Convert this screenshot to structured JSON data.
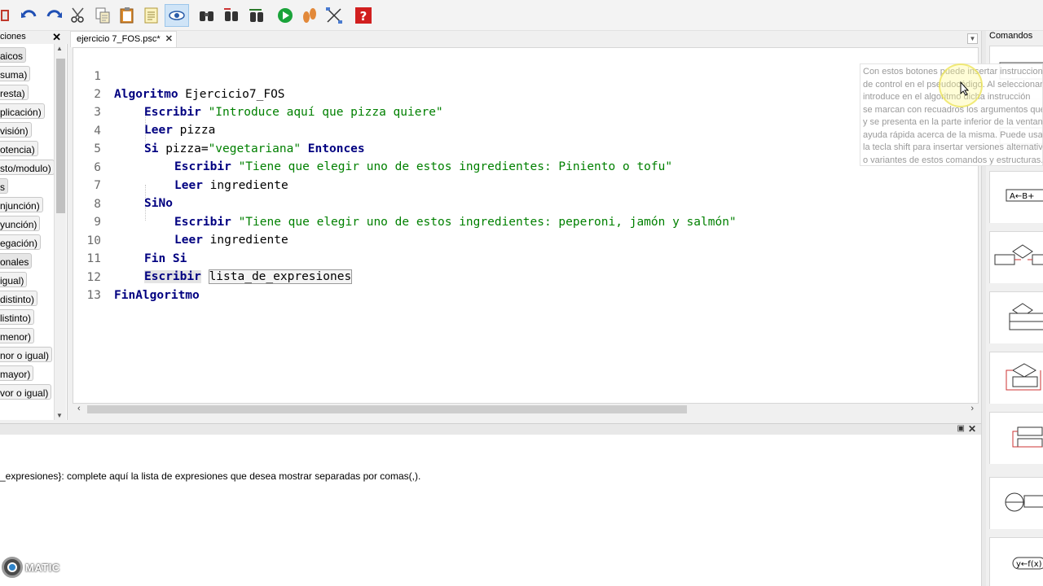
{
  "toolbar": {
    "buttons": [
      "open-icon",
      "undo-icon",
      "redo-icon",
      "cut-icon",
      "copy-icon",
      "paste-icon",
      "notes-icon",
      "find-preview-icon",
      "find-icon",
      "replace-icon",
      "indent-icon",
      "run-icon",
      "step-icon",
      "flow-icon",
      "help-icon"
    ]
  },
  "left_panel": {
    "title": "ciones",
    "items": [
      "aicos",
      "suma)",
      "resta)",
      "plicación)",
      "visión)",
      "otencia)",
      "sto/modulo)",
      "s",
      "njunción)",
      "yunción)",
      "egación)",
      "onales",
      "igual)",
      "distinto)",
      "listinto)",
      "menor)",
      "nor o igual)",
      "mayor)",
      "vor o igual)"
    ]
  },
  "tab": {
    "label": "ejercicio 7_FOS.psc*"
  },
  "code": {
    "lines": [
      {
        "n": "1"
      },
      {
        "n": "2"
      },
      {
        "n": "3"
      },
      {
        "n": "4"
      },
      {
        "n": "5"
      },
      {
        "n": "6"
      },
      {
        "n": "7"
      },
      {
        "n": "8"
      },
      {
        "n": "9"
      },
      {
        "n": "10"
      },
      {
        "n": "11"
      },
      {
        "n": "12"
      },
      {
        "n": "13"
      }
    ],
    "l1_kw": "Algoritmo",
    "l1_id": " Ejercicio7_FOS",
    "l2_kw": "Escribir",
    "l2_str": " \"Introduce aquí que pizza quiere\"",
    "l3_kw": "Leer",
    "l3_id": " pizza",
    "l4_kw": "Si",
    "l4_id": " pizza=",
    "l4_str": "\"vegetariana\"",
    "l4_kw2": " Entonces",
    "l5_kw": "Escribir",
    "l5_str": " \"Tiene que elegir uno de estos ingredientes: Piniento o tofu\"",
    "l6_kw": "Leer",
    "l6_id": " ingrediente",
    "l7_kw": "SiNo",
    "l8_kw": "Escribir",
    "l8_str": " \"Tiene que elegir uno de estos ingredientes: peperoni, jamón y salmón\"",
    "l9_kw": "Leer",
    "l9_id": " ingrediente",
    "l10_kw": "Fin Si",
    "l11_kw": "Escribir",
    "l11_arg": "lista_de_expresiones",
    "l12_kw": "FinAlgoritmo"
  },
  "help": {
    "text": "_expresiones}: complete aquí la lista de expresiones que desea mostrar separadas por comas(,)."
  },
  "logo": {
    "text": "MATIC"
  },
  "right_panel": {
    "title": "Comandos",
    "items": [
      "escribir-command-icon",
      "leer-command-icon",
      "asignar-command-icon",
      "si-entonces-command-icon",
      "segun-command-icon",
      "mientras-command-icon",
      "repetir-command-icon",
      "para-command-icon",
      "funcion-command-icon"
    ]
  },
  "tooltip": {
    "lines": [
      "Con estos botones puede insertar instruccion",
      "de control en el pseudocódigo. Al seleccionar",
      "introduce en el algoritmo dicha instrucción",
      "se marcan con recuadros los argumentos que",
      "y se presenta en la parte inferior de la ventana",
      "ayuda rápida acerca de la misma. Puede usar",
      "la tecla shift para insertar versiones alternativas",
      "o variantes de estos comandos y estructuras."
    ]
  },
  "colors": {
    "keyword": "#000080",
    "string": "#008000",
    "accent": "#2f83c9"
  }
}
